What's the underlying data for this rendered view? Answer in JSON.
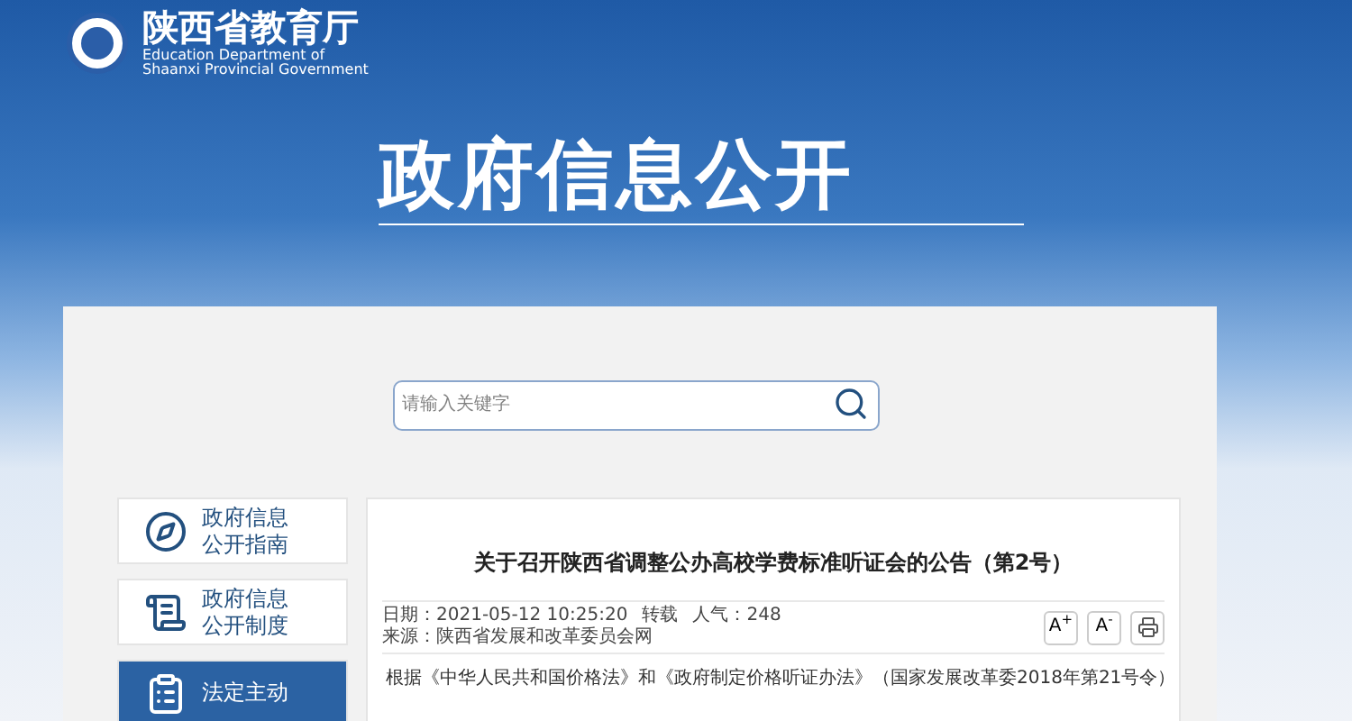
{
  "header": {
    "logo_title": "陕西省教育厅",
    "logo_subtitle_1": "Education Department of",
    "logo_subtitle_2": "Shaanxi Provincial Government"
  },
  "banner": {
    "title": "政府信息公开"
  },
  "search": {
    "placeholder": "请输入关键字"
  },
  "sidebar": {
    "items": [
      {
        "kind": "compass",
        "line_1": "政府信息",
        "line_2": "公开指南",
        "selected": false
      },
      {
        "kind": "list",
        "line_1": "政府信息",
        "line_2": "公开制度",
        "selected": false
      },
      {
        "kind": "clipboard",
        "line_1": "法定主动",
        "selected": true
      }
    ]
  },
  "article": {
    "title": "关于召开陕西省调整公办高校学费标准听证会的公告（第2号）",
    "date": "日期：2021-05-12 10:25:20",
    "repost": "转载",
    "views": "人气：248",
    "source": "来源：陕西省发展和改革委员会网",
    "font_buttons": [
      "A$^{+}$",
      "A$^{-}$"
    ],
    "body": "根据《中华人民共和国价格法》和《政府制定价格听证办法》（国家发展改革委2018年第21号令）"
  }
}
